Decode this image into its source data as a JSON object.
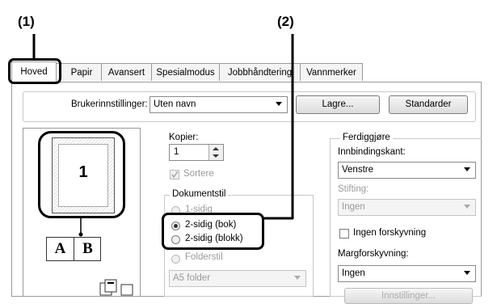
{
  "callouts": {
    "one": "(1)",
    "two": "(2)"
  },
  "tabs": [
    "Hoved",
    "Papir",
    "Avansert",
    "Spesialmodus",
    "Jobbhåndtering",
    "Vannmerker"
  ],
  "user_settings": {
    "label": "Brukerinnstillinger:",
    "value": "Uten navn",
    "save_button": "Lagre...",
    "defaults_button": "Standarder"
  },
  "preview": {
    "page_number": "1",
    "letter_a": "A",
    "letter_b": "B"
  },
  "copies": {
    "label": "Kopier:",
    "value": "1"
  },
  "collate": {
    "label": "Sortere",
    "checked": true
  },
  "document_style": {
    "legend": "Dokumentstil",
    "options": [
      "1-sidig",
      "2-sidig (bok)",
      "2-sidig (blokk)",
      "Folderstil"
    ],
    "selected": "2-sidig (bok)",
    "folder_value": "A5 folder"
  },
  "finishing": {
    "legend": "Ferdiggjøre",
    "binding_label": "Innbindingskant:",
    "binding_value": "Venstre",
    "staple_label": "Stifting:",
    "staple_value": "Ingen",
    "no_shift_label": "Ingen forskyvning",
    "margin_label": "Margforskyvning:",
    "margin_value": "Ingen",
    "settings_button": "Innstillinger..."
  }
}
